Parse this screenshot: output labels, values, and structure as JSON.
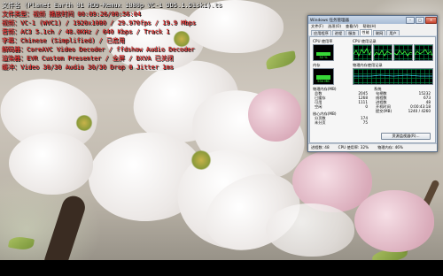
{
  "player": {
    "title_line": "文件名 (Planet Earth 01 HDD-Remux 1080p VC-1 DD5.1.Disk1).ts",
    "osd_lines": [
      "文件类型：视频  播放时间 00:09:26/00:56:04",
      "视频：VC-1 (WVC1) / 1920x1080 / 29.970fps / 19.9 Mbps",
      "音频：AC3 5.1ch / 48.0KHz / 640 Kbps / Track 1",
      "字幕：Chinese (Simplified) / 已启用",
      "解码器：CoreAVC Video Decoder / ffdshow Audio Decoder",
      "渲染器：EVR Custom Presenter / 全屏 / DXVA 已关闭",
      "缓冲：Video 30/30  Audio 30/30  Drop 0  Jitter 1ms"
    ]
  },
  "taskmgr": {
    "title": "Windows 任务管理器",
    "controls": {
      "minimize": "–",
      "maximize": "□",
      "close": "✕"
    },
    "menu": [
      "文件(F)",
      "选项(O)",
      "查看(V)",
      "帮助(H)"
    ],
    "tabs": [
      "应用程序",
      "进程",
      "服务",
      "性能",
      "联网",
      "用户"
    ],
    "active_tab": "性能",
    "cpu_usage_label": "CPU 使用率",
    "cpu_usage_value": "32 %",
    "cpu_usage_fraction": 0.32,
    "cpu_history_label": "CPU 使用记录",
    "mem_label": "内存",
    "mem_value": "934 MB",
    "mem_fraction": 0.45,
    "mem_history_label": "物理内存使用记录",
    "physical_mem": {
      "header": "物理内存(MB)",
      "rows": [
        {
          "k": "总数",
          "v": "2045"
        },
        {
          "k": "已缓存",
          "v": "1268"
        },
        {
          "k": "可用",
          "v": "1111"
        },
        {
          "k": "空闲",
          "v": "0"
        }
      ]
    },
    "system": {
      "header": "系统",
      "rows": [
        {
          "k": "句柄数",
          "v": "15232"
        },
        {
          "k": "线程数",
          "v": "673"
        },
        {
          "k": "进程数",
          "v": "48"
        },
        {
          "k": "开机时间",
          "v": "0:00:43:18"
        },
        {
          "k": "提交(MB)",
          "v": "1240 / 4260"
        }
      ]
    },
    "kernel_mem": {
      "header": "核心内存(MB)",
      "rows": [
        {
          "k": "分页数",
          "v": "174"
        },
        {
          "k": "未分页",
          "v": "75"
        }
      ]
    },
    "resource_monitor_button": "资源监视器(R)...",
    "status": {
      "processes": "进程数: 48",
      "cpu": "CPU 使用率: 32%",
      "memory": "物理内存: 46%"
    }
  }
}
